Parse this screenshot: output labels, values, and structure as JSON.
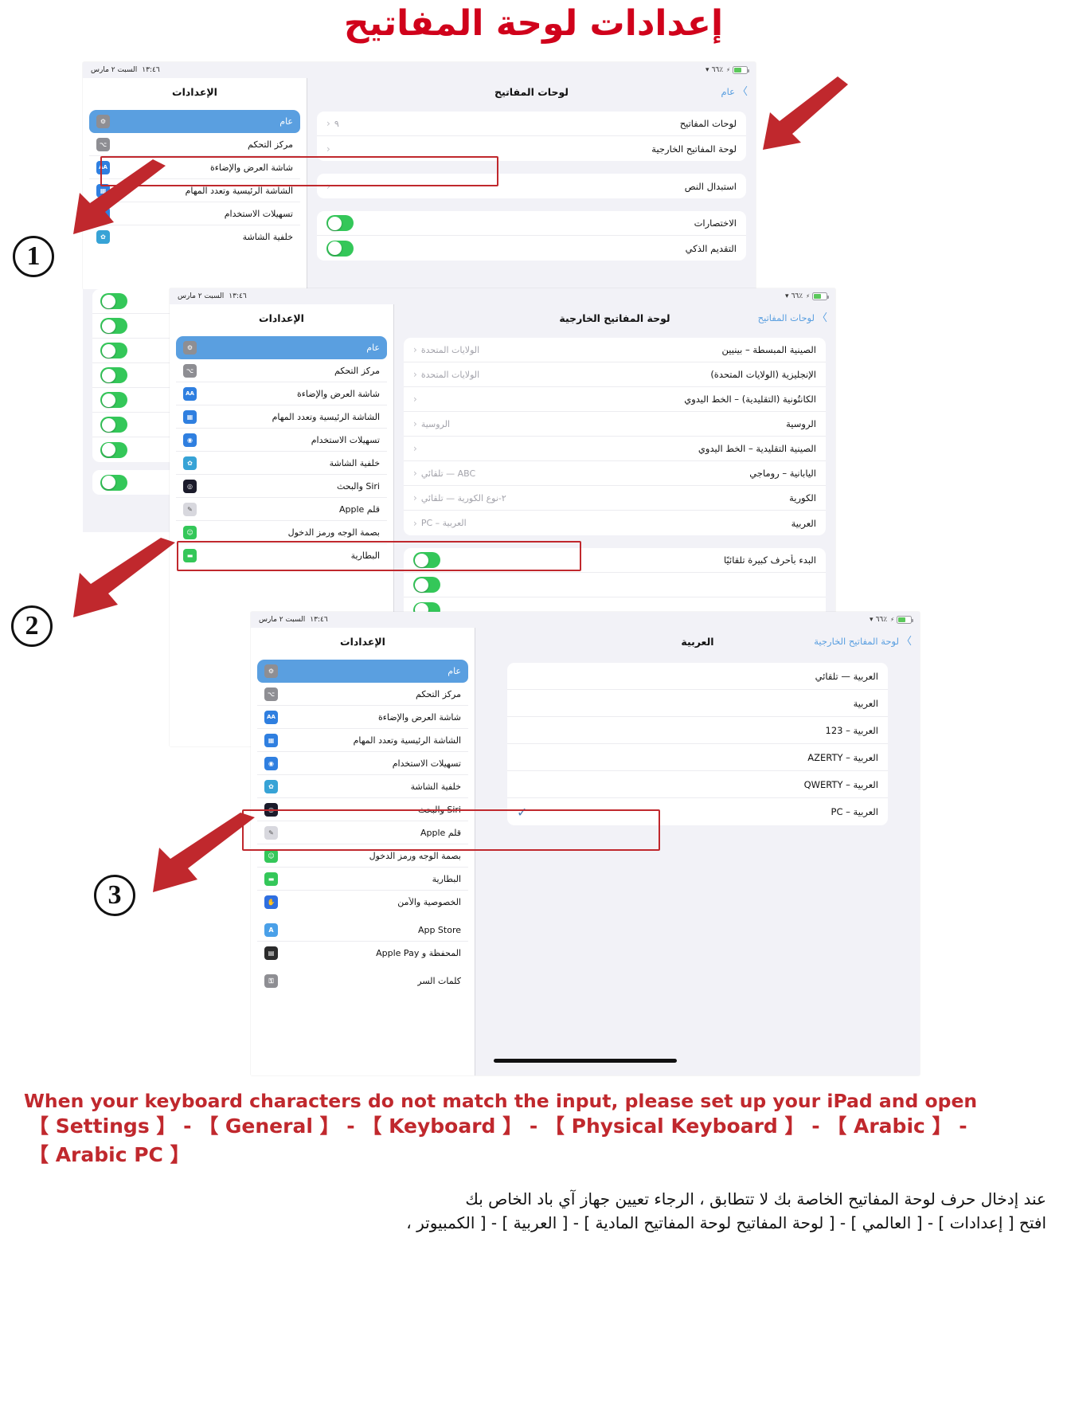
{
  "page": {
    "title": "إعدادات لوحة المفاتيح",
    "title_color": "#d0021b",
    "accent_blue": "#5a9fe0",
    "highlight_red": "#c0282d",
    "toggle_green": "#34c759"
  },
  "status_bar": {
    "time": "١٣:٤٦",
    "date": "السبت ٢ مارس",
    "battery": "٪٦٦"
  },
  "steps": [
    "1",
    "2",
    "3"
  ],
  "panel1": {
    "detail": {
      "title": "لوحات المفاتيح",
      "back": "عام",
      "rows": [
        {
          "label": "لوحات المفاتيح",
          "value": "٩",
          "chevron": "‹"
        },
        {
          "label": "لوحة المفاتيح الخارجية",
          "value": "",
          "chevron": "‹",
          "highlighted": true
        },
        {
          "label": "استبدال النص",
          "value": "",
          "chevron": "‹"
        }
      ],
      "toggles": [
        {
          "label": "الاختصارات",
          "on": true
        },
        {
          "label": "التقديم الذكي",
          "on": true
        },
        {
          "label": "",
          "on": true
        },
        {
          "label": "",
          "on": true
        },
        {
          "label": "",
          "on": true
        },
        {
          "label": "",
          "on": true
        },
        {
          "label": "",
          "on": true
        },
        {
          "label": "",
          "on": true
        },
        {
          "label": "",
          "on": true
        },
        {
          "label": "",
          "on": true
        }
      ]
    },
    "settings": {
      "title": "الإعدادات",
      "items": [
        {
          "label": "عام",
          "icon": "gear-icon",
          "color": "#8e8e93",
          "glyph": "⚙",
          "selected": true
        },
        {
          "label": "مركز التحكم",
          "icon": "control-center-icon",
          "color": "#8e8e93",
          "glyph": "⌥"
        },
        {
          "label": "شاشة العرض والإضاءة",
          "icon": "display-brightness-icon",
          "color": "#2f7fe0",
          "glyph": "AA"
        },
        {
          "label": "الشاشة الرئيسية وتعدد المهام",
          "icon": "home-screen-icon",
          "color": "#2f7fe0",
          "glyph": "▦"
        },
        {
          "label": "تسهيلات الاستخدام",
          "icon": "accessibility-icon",
          "color": "#2f7fe0",
          "glyph": "◉"
        },
        {
          "label": "خلفية الشاشة",
          "icon": "wallpaper-icon",
          "color": "#37a3d6",
          "glyph": "✿"
        }
      ]
    }
  },
  "panel2": {
    "detail": {
      "title": "لوحة المفاتيح الخارجية",
      "back": "لوحات المفاتيح",
      "rows": [
        {
          "label": "الصينية المبسطة – بينيين",
          "value": "الولايات المتحدة",
          "chevron": "‹"
        },
        {
          "label": "الإنجليزية (الولايات المتحدة)",
          "value": "الولايات المتحدة",
          "chevron": "‹"
        },
        {
          "label": "الكانتُونية (التقليدية) – الخط اليدوي",
          "value": "",
          "chevron": "‹"
        },
        {
          "label": "الروسية",
          "value": "الروسية",
          "chevron": "‹"
        },
        {
          "label": "الصينية التقليدية – الخط اليدوي",
          "value": "",
          "chevron": "‹"
        },
        {
          "label": "اليابانية – روماجي",
          "value": "ABC — تلقائي",
          "chevron": "‹"
        },
        {
          "label": "الكورية",
          "value": "٢-نوع الكورية — تلقائي",
          "chevron": "‹"
        },
        {
          "label": "العربية",
          "value": "العربية – PC",
          "chevron": "‹",
          "highlighted": true
        }
      ],
      "toggles": [
        {
          "label": "البدء بأحرف كبيرة تلقائيًا",
          "on": true
        },
        {
          "label": "",
          "on": true
        },
        {
          "label": "",
          "on": true
        },
        {
          "label": "",
          "on": true
        }
      ]
    },
    "settings": {
      "title": "الإعدادات",
      "items": [
        {
          "label": "عام",
          "icon": "gear-icon",
          "color": "#8e8e93",
          "glyph": "⚙",
          "selected": true
        },
        {
          "label": "مركز التحكم",
          "icon": "control-center-icon",
          "color": "#8e8e93",
          "glyph": "⌥"
        },
        {
          "label": "شاشة العرض والإضاءة",
          "icon": "display-brightness-icon",
          "color": "#2f7fe0",
          "glyph": "AA"
        },
        {
          "label": "الشاشة الرئيسية وتعدد المهام",
          "icon": "home-screen-icon",
          "color": "#2f7fe0",
          "glyph": "▦"
        },
        {
          "label": "تسهيلات الاستخدام",
          "icon": "accessibility-icon",
          "color": "#2f7fe0",
          "glyph": "◉"
        },
        {
          "label": "خلفية الشاشة",
          "icon": "wallpaper-icon",
          "color": "#37a3d6",
          "glyph": "✿"
        },
        {
          "label": "Siri والبحث",
          "icon": "siri-icon",
          "color": "#1b1b2b",
          "glyph": "◎"
        },
        {
          "label": "قلم Apple",
          "icon": "apple-pencil-icon",
          "color": "#d8d8de",
          "glyph": "✎"
        },
        {
          "label": "بصمة الوجه ورمز الدخول",
          "icon": "face-id-icon",
          "color": "#34c759",
          "glyph": "☺"
        },
        {
          "label": "البطارية",
          "icon": "battery-icon",
          "color": "#34c759",
          "glyph": "▬"
        }
      ]
    }
  },
  "panel3": {
    "detail": {
      "title": "العربية",
      "back": "لوحة المفاتيح الخارجية",
      "options": [
        {
          "label": "العربية — تلقائي",
          "checked": false
        },
        {
          "label": "العربية",
          "checked": false
        },
        {
          "label": "العربية – 123",
          "checked": false
        },
        {
          "label": "العربية – AZERTY",
          "checked": false
        },
        {
          "label": "العربية – QWERTY",
          "checked": false
        },
        {
          "label": "العربية – PC",
          "checked": true,
          "highlighted": true
        }
      ],
      "check_glyph": "✓"
    },
    "settings": {
      "title": "الإعدادات",
      "items": [
        {
          "label": "عام",
          "icon": "gear-icon",
          "color": "#8e8e93",
          "glyph": "⚙",
          "selected": true
        },
        {
          "label": "مركز التحكم",
          "icon": "control-center-icon",
          "color": "#8e8e93",
          "glyph": "⌥"
        },
        {
          "label": "شاشة العرض والإضاءة",
          "icon": "display-brightness-icon",
          "color": "#2f7fe0",
          "glyph": "AA"
        },
        {
          "label": "الشاشة الرئيسية وتعدد المهام",
          "icon": "home-screen-icon",
          "color": "#2f7fe0",
          "glyph": "▦"
        },
        {
          "label": "تسهيلات الاستخدام",
          "icon": "accessibility-icon",
          "color": "#2f7fe0",
          "glyph": "◉"
        },
        {
          "label": "خلفية الشاشة",
          "icon": "wallpaper-icon",
          "color": "#37a3d6",
          "glyph": "✿"
        },
        {
          "label": "Siri والبحث",
          "icon": "siri-icon",
          "color": "#1b1b2b",
          "glyph": "◎"
        },
        {
          "label": "قلم Apple",
          "icon": "apple-pencil-icon",
          "color": "#d8d8de",
          "glyph": "✎"
        },
        {
          "label": "بصمة الوجه ورمز الدخول",
          "icon": "face-id-icon",
          "color": "#34c759",
          "glyph": "☺"
        },
        {
          "label": "البطارية",
          "icon": "battery-icon",
          "color": "#34c759",
          "glyph": "▬"
        },
        {
          "label": "الخصوصية والأمن",
          "icon": "privacy-hand-icon",
          "color": "#2f6fe0",
          "glyph": "✋"
        }
      ],
      "group2": [
        {
          "label": "App Store",
          "icon": "app-store-icon",
          "color": "#4aa0e8",
          "glyph": "A"
        },
        {
          "label": "المحفظة و Apple Pay",
          "icon": "wallet-icon",
          "color": "#2b2b2b",
          "glyph": "▤"
        }
      ],
      "group3": [
        {
          "label": "كلمات السر",
          "icon": "passwords-key-icon",
          "color": "#8e8e93",
          "glyph": "⚿"
        }
      ]
    }
  },
  "footer": {
    "en_line1": "When your keyboard characters do not match the input, please set up your iPad and open",
    "en_line2": "【 Settings 】 - 【 General 】 - 【 Keyboard 】 - 【 Physical Keyboard 】 - 【 Arabic 】 -",
    "en_line3": "【 Arabic PC 】",
    "ar_line1": "عند إدخال حرف لوحة المفاتيح الخاصة بك لا تتطابق ، الرجاء تعيين جهاز آي باد الخاص بك",
    "ar_line2": "افتح [ إعدادات ] - [ العالمي ] - [ لوحة المفاتيح لوحة المفاتيح المادية ] - [ العربية ] - [ الكمبيوتر ،"
  }
}
